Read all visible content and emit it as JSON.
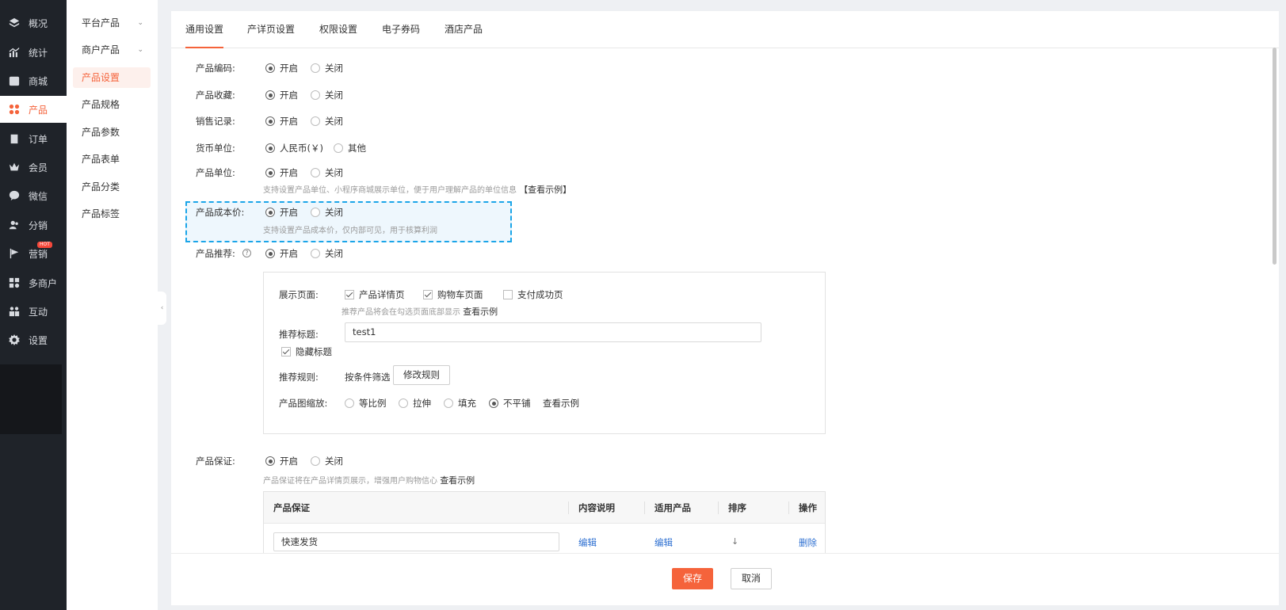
{
  "sidebar": {
    "items": [
      {
        "label": "概况",
        "icon": "layers-icon"
      },
      {
        "label": "统计",
        "icon": "chart-icon"
      },
      {
        "label": "商城",
        "icon": "store-icon"
      },
      {
        "label": "产品",
        "icon": "grid-icon"
      },
      {
        "label": "订单",
        "icon": "clipboard-icon"
      },
      {
        "label": "会员",
        "icon": "crown-icon"
      },
      {
        "label": "微信",
        "icon": "wechat-icon"
      },
      {
        "label": "分销",
        "icon": "users-icon"
      },
      {
        "label": "营销",
        "icon": "flag-icon",
        "badge": "HOT"
      },
      {
        "label": "多商户",
        "icon": "shop-icon"
      },
      {
        "label": "互动",
        "icon": "interact-icon"
      },
      {
        "label": "设置",
        "icon": "gear-icon"
      }
    ],
    "active_index": 3
  },
  "submenu": {
    "items": [
      {
        "label": "平台产品",
        "chevron": "⌄"
      },
      {
        "label": "商户产品",
        "chevron": "⌄"
      },
      {
        "label": "产品设置"
      },
      {
        "label": "产品规格"
      },
      {
        "label": "产品参数"
      },
      {
        "label": "产品表单"
      },
      {
        "label": "产品分类"
      },
      {
        "label": "产品标签"
      }
    ],
    "active_index": 2,
    "collapse_glyph": "‹"
  },
  "tabs": [
    "通用设置",
    "产详页设置",
    "权限设置",
    "电子券码",
    "酒店产品"
  ],
  "settings": {
    "code": {
      "label": "产品编码:",
      "on": "开启",
      "off": "关闭"
    },
    "favorite": {
      "label": "产品收藏:",
      "on": "开启",
      "off": "关闭"
    },
    "sales": {
      "label": "销售记录:",
      "on": "开启",
      "off": "关闭"
    },
    "currency": {
      "label": "货币单位:",
      "on": "人民币(￥)",
      "off": "其他"
    },
    "unit": {
      "label": "产品单位:",
      "on": "开启",
      "off": "关闭",
      "hint": "支持设置产品单位、小程序商城展示单位，便于用户理解产品的单位信息",
      "hint_link": "【查看示例】"
    },
    "cost": {
      "label": "产品成本价:",
      "on": "开启",
      "off": "关闭",
      "hint": "支持设置产品成本价，仅内部可见，用于核算利润"
    },
    "recommend": {
      "label": "产品推荐:",
      "help": "?",
      "on": "开启",
      "off": "关闭"
    },
    "guarantee": {
      "label": "产品保证:",
      "on": "开启",
      "off": "关闭",
      "hint": "产品保证将在产品详情页展示，增强用户购物信心",
      "hint_link": "查看示例"
    }
  },
  "recommend_box": {
    "display_label": "展示页面:",
    "display_options": [
      {
        "label": "产品详情页",
        "checked": true
      },
      {
        "label": "购物车页面",
        "checked": true
      },
      {
        "label": "支付成功页",
        "checked": false
      }
    ],
    "display_hint": "推荐产品将会在勾选页面底部显示",
    "display_hint_link": "查看示例",
    "title_label": "推荐标题:",
    "title_value": "test1",
    "hide_title_label": "隐藏标题",
    "hide_title_checked": true,
    "rule_label": "推荐规则:",
    "rule_value": "按条件筛选",
    "rule_button": "修改规则",
    "scale_label": "产品图缩放:",
    "scale_options": [
      "等比例",
      "拉伸",
      "填充",
      "不平铺"
    ],
    "scale_selected": 3,
    "scale_link": "查看示例"
  },
  "guarantee_table": {
    "headers": [
      "产品保证",
      "内容说明",
      "适用产品",
      "排序",
      "操作"
    ],
    "rows": [
      {
        "name": "快速发货",
        "desc": "编辑",
        "products": "编辑",
        "sort": "↓",
        "action": "删除"
      }
    ]
  },
  "footer": {
    "save": "保存",
    "cancel": "取消"
  },
  "colors": {
    "accent": "#f5633b",
    "sidebar_bg": "#1f2329",
    "link": "#2d6fd1",
    "highlight_border": "#1ba5e8"
  }
}
